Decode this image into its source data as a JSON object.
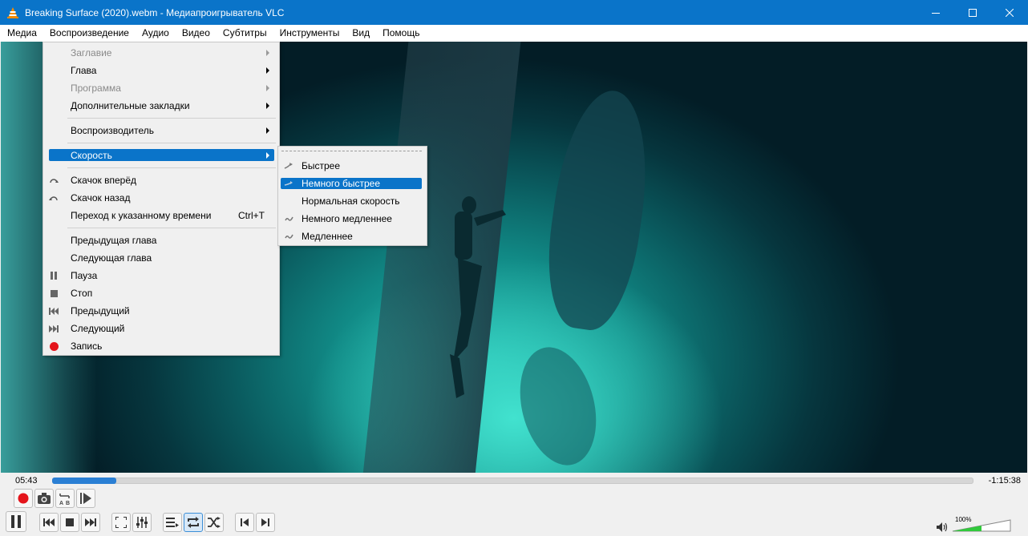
{
  "window": {
    "title": "Breaking Surface (2020).webm - Медиапроигрыватель VLC",
    "minimize_icon": "minimize-icon",
    "maximize_icon": "maximize-icon",
    "close_icon": "close-icon"
  },
  "menubar": [
    "Медиа",
    "Воспроизведение",
    "Аудио",
    "Видео",
    "Субтитры",
    "Инструменты",
    "Вид",
    "Помощь"
  ],
  "playback_menu": {
    "items": [
      {
        "label": "Заглавие",
        "disabled": true,
        "submenu": true
      },
      {
        "label": "Глава",
        "submenu": true
      },
      {
        "label": "Программа",
        "disabled": true,
        "submenu": true
      },
      {
        "label": "Дополнительные закладки",
        "submenu": true
      },
      {
        "label": "Воспроизводитель",
        "submenu": true
      },
      {
        "label": "Скорость",
        "submenu": true,
        "selected": true
      },
      {
        "label": "Скачок вперёд",
        "icon": "jump-forward-icon"
      },
      {
        "label": "Скачок назад",
        "icon": "jump-backward-icon"
      },
      {
        "label": "Переход к указанному времени",
        "shortcut": "Ctrl+T"
      },
      {
        "label": "Предыдущая глава"
      },
      {
        "label": "Следующая глава"
      },
      {
        "label": "Пауза",
        "icon": "pause-icon"
      },
      {
        "label": "Стоп",
        "icon": "stop-icon"
      },
      {
        "label": "Предыдущий",
        "icon": "previous-icon"
      },
      {
        "label": "Следующий",
        "icon": "next-icon"
      },
      {
        "label": "Запись",
        "icon": "record-icon"
      }
    ]
  },
  "speed_menu": {
    "items": [
      {
        "label": "Быстрее",
        "icon": "faster-icon"
      },
      {
        "label": "Немного быстрее",
        "icon": "slightly-faster-icon",
        "selected": true
      },
      {
        "label": "Нормальная скорость"
      },
      {
        "label": "Немного медленнее",
        "icon": "slightly-slower-icon"
      },
      {
        "label": "Медленнее",
        "icon": "slower-icon"
      }
    ]
  },
  "player": {
    "time_elapsed": "05:43",
    "time_remaining": "-1:15:38",
    "progress_fraction": 0.07,
    "volume_label": "100%",
    "volume_fraction": 1.0
  },
  "colors": {
    "accent": "#0a74c9",
    "record": "#e4141b",
    "volume_green": "#31c93c"
  }
}
